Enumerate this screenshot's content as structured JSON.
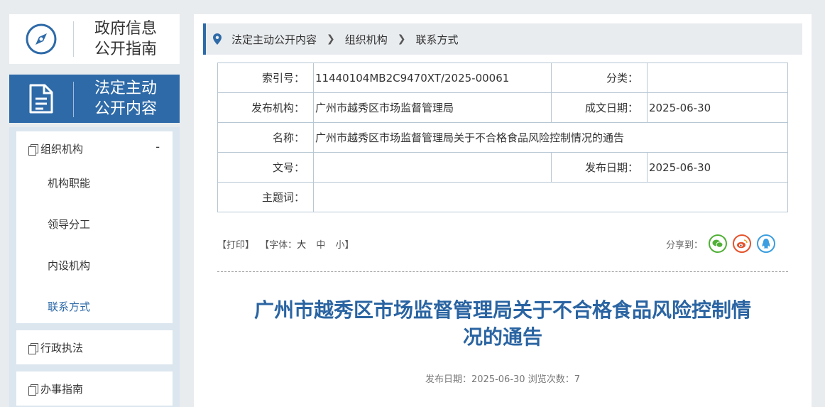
{
  "sidebar": {
    "guide_title_line1": "政府信息",
    "guide_title_line2": "公开指南",
    "active_title_line1": "法定主动",
    "active_title_line2": "公开内容",
    "group": {
      "label": "组织机构",
      "toggle": "-",
      "items": [
        "机构职能",
        "领导分工",
        "内设机构",
        "联系方式"
      ]
    },
    "other_groups": [
      "行政执法",
      "办事指南"
    ]
  },
  "breadcrumb": [
    "法定主动公开内容",
    "组织机构",
    "联系方式"
  ],
  "meta": {
    "index_label": "索引号：",
    "index_value": "11440104MB2C9470XT/2025-00061",
    "category_label": "分类：",
    "category_value": "",
    "publisher_label": "发布机构：",
    "publisher_value": "广州市越秀区市场监督管理局",
    "written_date_label": "成文日期：",
    "written_date_value": "2025-06-30",
    "name_label": "名称：",
    "name_value": "广州市越秀区市场监督管理局关于不合格食品风险控制情况的通告",
    "doc_no_label": "文号：",
    "doc_no_value": "",
    "pub_date_label": "发布日期：",
    "pub_date_value": "2025-06-30",
    "subject_label": "主题词：",
    "subject_value": ""
  },
  "tools": {
    "print": "【打印】",
    "font_open": "【字体：",
    "font_large": "大",
    "font_medium": "中",
    "font_small": "小",
    "font_close": "】",
    "share_label": "分享到："
  },
  "article": {
    "title_line1": "广州市越秀区市场监督管理局关于不合格食品风险控制情",
    "title_line2": "况的通告",
    "pub_line": "发布日期：2025-06-30   浏览次数：7"
  },
  "colors": {
    "accent": "#2e6aa8",
    "title": "#2a64a2",
    "wechat": "#4fb035",
    "weibo": "#e5532d",
    "qq": "#3a9ee0"
  }
}
